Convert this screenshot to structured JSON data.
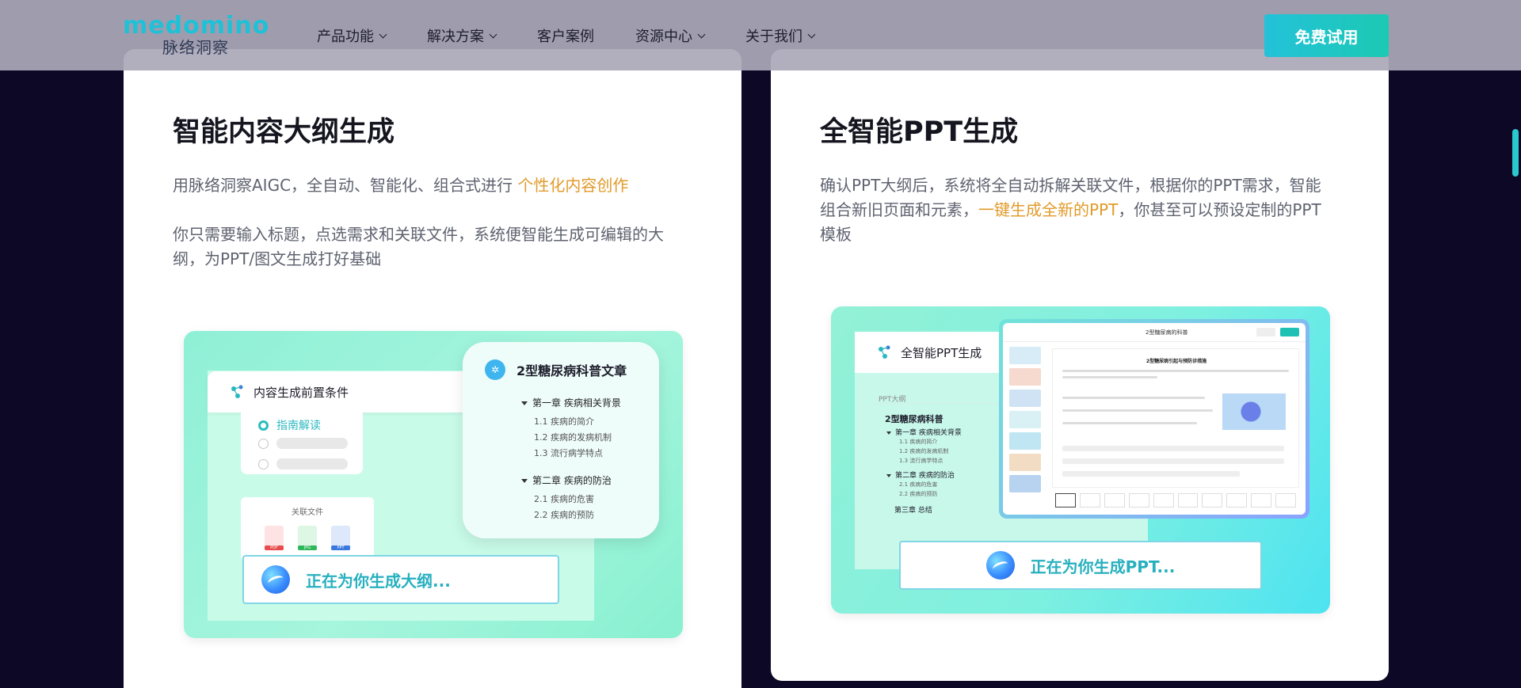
{
  "nav": {
    "logo_text": "medomino",
    "logo_cn": "脉络洞察",
    "items": [
      {
        "label": "产品功能",
        "dropdown": true
      },
      {
        "label": "解决方案",
        "dropdown": true
      },
      {
        "label": "客户案例",
        "dropdown": false
      },
      {
        "label": "资源中心",
        "dropdown": true
      },
      {
        "label": "关于我们",
        "dropdown": true
      }
    ],
    "cta": "免费试用"
  },
  "left": {
    "title": "智能内容大纲生成",
    "p1_pre": "用脉络洞察AIGC，全自动、智能化、组合式进行 ",
    "p1_hl": "个性化内容创作",
    "p2": "你只需要输入标题，点选需求和关联文件，系统便智能生成可编辑的大纲，为PPT/图文生成打好基础",
    "ill": {
      "panel_title": "内容生成前置条件",
      "option_1": "指南解读",
      "files_title": "关联文件",
      "file_types": [
        "PDF",
        "JPG",
        "PPT"
      ],
      "status": "正在为你生成大纲...",
      "outline_title": "2型糖尿病科普文章",
      "chapters": [
        {
          "title": "第一章 疾病相关背景",
          "sections": [
            "1.1 疾病的简介",
            "1.2 疾病的发病机制",
            "1.3 流行病学特点"
          ]
        },
        {
          "title": "第二章 疾病的防治",
          "sections": [
            "2.1 疾病的危害",
            "2.2 疾病的预防"
          ]
        }
      ]
    }
  },
  "right": {
    "title": "全智能PPT生成",
    "p_pre": "确认PPT大纲后，系统将全自动拆解关联文件，根据你的PPT需求，智能组合新旧页面和元素，",
    "p_hl": "一键生成全新的PPT",
    "p_post": "，你甚至可以预设定制的PPT模板",
    "ill": {
      "panel_title": "全智能PPT生成",
      "outline_label": "PPT大纲",
      "outline_title": "2型糖尿病科普",
      "chapters": [
        {
          "title": "第一章 疾病相关背景",
          "sections": [
            "1.1 疾病的简介",
            "1.2 疾病的发病机制",
            "1.3 流行病学特点"
          ]
        },
        {
          "title": "第二章 疾病的防治",
          "sections": [
            "2.1 疾病的危害",
            "2.2 疾病的预防"
          ]
        }
      ],
      "chapter_3": "第三章 总结",
      "app_title": "2型糖尿病的科普",
      "slide_title": "2型糖尿病引起与预防诊措施",
      "status": "正在为你生成PPT..."
    }
  },
  "colors": {
    "accent": "#1fc1d6",
    "highlight": "#e19b2b",
    "background": "#0c0826"
  }
}
